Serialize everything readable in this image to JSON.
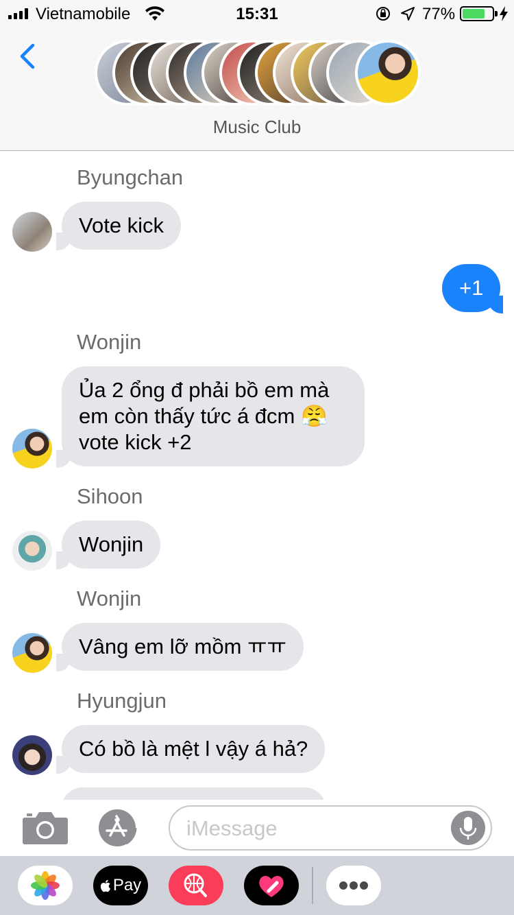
{
  "status_bar": {
    "carrier": "Vietnamobile",
    "time": "15:31",
    "battery_percent": "77%",
    "battery_level": 0.77
  },
  "header": {
    "group_name": "Music Club"
  },
  "messages": [
    {
      "sender": "Byungchan",
      "text": "Vote kick",
      "direction": "incoming"
    },
    {
      "text": "+1",
      "direction": "outgoing"
    },
    {
      "sender": "Wonjin",
      "text": "Ủa 2 ổng đ phải bồ em mà\nem còn thấy tức á đcm 😤\nvote kick +2",
      "direction": "incoming"
    },
    {
      "sender": "Sihoon",
      "text": "Wonjin",
      "direction": "incoming"
    },
    {
      "sender": "Wonjin",
      "text": "Vâng em lỡ mồm ㅠㅠ",
      "direction": "incoming"
    },
    {
      "sender": "Hyungjun",
      "text": "Có bồ là mệt l vậy á hả?",
      "direction": "incoming"
    }
  ],
  "input": {
    "placeholder": "iMessage"
  },
  "app_drawer": {
    "apple_pay_label": "Pay"
  },
  "colors": {
    "outgoing_bubble": "#1a82fb",
    "incoming_bubble": "#e5e5ea",
    "back_chevron": "#1a82fb",
    "battery_fill": "#4cd964",
    "search_app": "#fa3e5a"
  }
}
